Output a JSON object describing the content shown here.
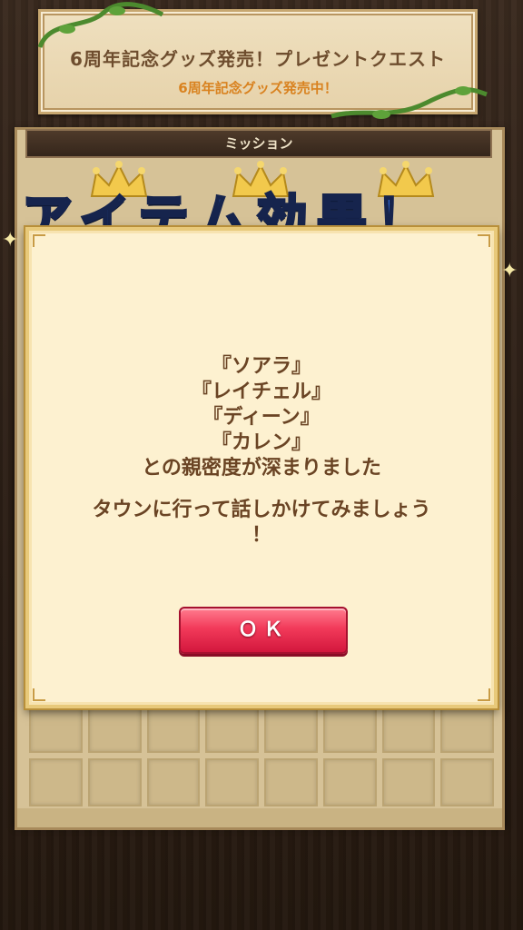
{
  "banner": {
    "title": "6周年記念グッズ発売！プレゼントクエスト",
    "subtitle": "6周年記念グッズ発売中！"
  },
  "mission": {
    "header": "ミッション",
    "overlay_title": "アイテム効果！"
  },
  "dialog": {
    "lines": [
      "『ソアラ』",
      "『レイチェル』",
      "『ディーン』",
      "『カレン』",
      "との親密度が深まりました"
    ],
    "hint_line1": "タウンに行って話しかけてみましょう",
    "hint_line2": "！",
    "ok_label": "ＯＫ"
  },
  "colors": {
    "accent_button": "#f23a5a",
    "dialog_bg": "#fdf1d0",
    "text_brown": "#6a4424",
    "title_blue": "#2e63c9"
  },
  "icons": [
    "crown-icon",
    "vine-icon",
    "sparkle-icon"
  ]
}
